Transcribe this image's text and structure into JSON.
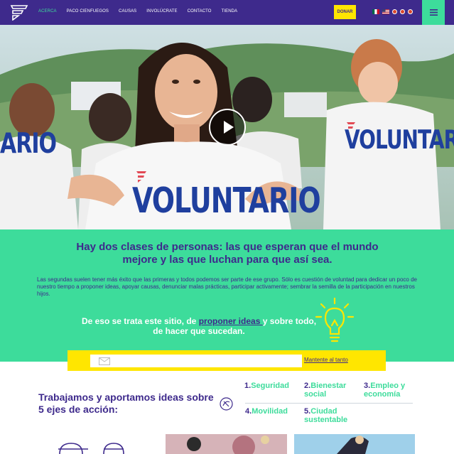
{
  "nav": {
    "links": [
      {
        "label": "ACERCA",
        "active": true
      },
      {
        "label": "PACO CIENFUEGOS",
        "active": false
      },
      {
        "label": "CAUSAS",
        "active": false
      },
      {
        "label": "INVOLÚCRATE",
        "active": false
      },
      {
        "label": "CONTACTO",
        "active": false
      },
      {
        "label": "TIENDA",
        "active": false
      }
    ],
    "donate_label": "DONAR",
    "flags": [
      "mexico-flag-icon",
      "usa-flag-icon"
    ],
    "social_icons": [
      "facebook-icon",
      "twitter-icon",
      "youtube-icon"
    ]
  },
  "hero": {
    "shirt_text_main": "VOLUNTARIO",
    "shirt_text_left": "ARIO",
    "shirt_text_right": "VOLUNTARIO"
  },
  "intro": {
    "headline": "Hay dos clases de personas: las que esperan que el mundo mejore y las que luchan para que así sea.",
    "body": "Las segundas suelen tener más éxito que las primeras y todos podemos ser parte de ese grupo. Sólo es cuestión de voluntad para dedicar un poco de nuestro tiempo a proponer ideas, apoyar causas, denunciar malas prácticas, participar activamente; sembrar la semilla de la participación en nuestros hijos.",
    "tagline_before": "De eso se trata este sitio, de ",
    "tagline_highlight": "proponer ideas ",
    "tagline_after": "y sobre todo, de hacer que sucedan."
  },
  "subscribe": {
    "placeholder": "",
    "link_label": "Mantente al tanto"
  },
  "axes": {
    "title": "Trabajamos y aportamos ideas sobre 5 ejes de acción:",
    "items": [
      {
        "num": "1.",
        "label": "Seguridad"
      },
      {
        "num": "2.",
        "label": "Bienestar social"
      },
      {
        "num": "3.",
        "label": "Empleo y economía"
      },
      {
        "num": "4.",
        "label": "Movilidad"
      },
      {
        "num": "5.",
        "label": "Ciudad sustentable"
      }
    ]
  },
  "colors": {
    "brand_purple": "#3e2a8c",
    "brand_green": "#3ddc9b",
    "brand_yellow": "#ffe600"
  }
}
